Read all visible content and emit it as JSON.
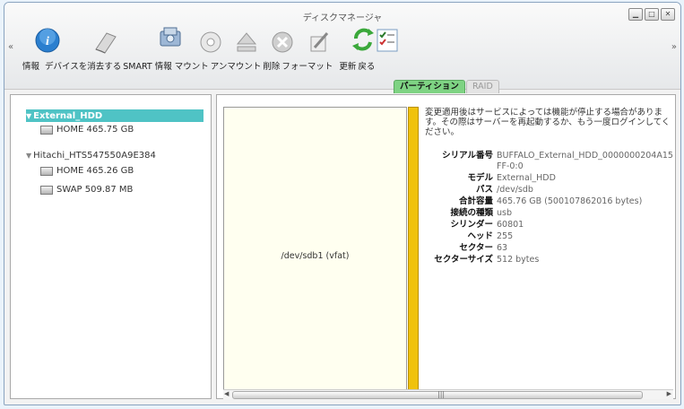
{
  "window": {
    "title": "ディスクマネージャ"
  },
  "toolbar": {
    "labels": [
      "情報",
      "デバイスを消去する",
      "SMART 情報",
      "マウント",
      "アンマウント",
      "削除",
      "フォーマット",
      "更新",
      "戻る"
    ]
  },
  "tabs": [
    {
      "label": "パーティション",
      "active": true
    },
    {
      "label": "RAID",
      "active": false
    }
  ],
  "tree": {
    "disks": [
      {
        "name": "External_HDD",
        "partitions": [
          {
            "label": "HOME 465.75 GB"
          }
        ]
      },
      {
        "name": "Hitachi_HTS547550A9E384",
        "partitions": [
          {
            "label": "HOME 465.26 GB"
          },
          {
            "label": "SWAP 509.87 MB"
          }
        ]
      }
    ]
  },
  "partition": {
    "label": "/dev/sdb1 (vfat)"
  },
  "notice": "変更適用後はサービスによっては機能が停止する場合があります。その際はサーバーを再起動するか、もう一度ログインしてください。",
  "details": [
    {
      "key": "シリアル番号",
      "value": "BUFFALO_External_HDD_0000000204A15FF-0:0"
    },
    {
      "key": "モデル",
      "value": "External_HDD"
    },
    {
      "key": "パス",
      "value": "/dev/sdb"
    },
    {
      "key": "合計容量",
      "value": "465.76 GB (500107862016 bytes)"
    },
    {
      "key": "接続の種類",
      "value": "usb"
    },
    {
      "key": "シリンダー",
      "value": "60801"
    },
    {
      "key": "ヘッド",
      "value": "255"
    },
    {
      "key": "セクター",
      "value": "63"
    },
    {
      "key": "セクターサイズ",
      "value": "512 bytes"
    }
  ],
  "colors": {
    "selection": "#4fc3c5",
    "activeTab": "#7ed383",
    "partitionBar": "#f0c20c"
  },
  "icons": [
    "info-icon",
    "eraser-icon",
    "smart-icon",
    "mount-icon",
    "unmount-icon",
    "delete-icon",
    "format-icon",
    "refresh-icon",
    "checklist-icon"
  ]
}
